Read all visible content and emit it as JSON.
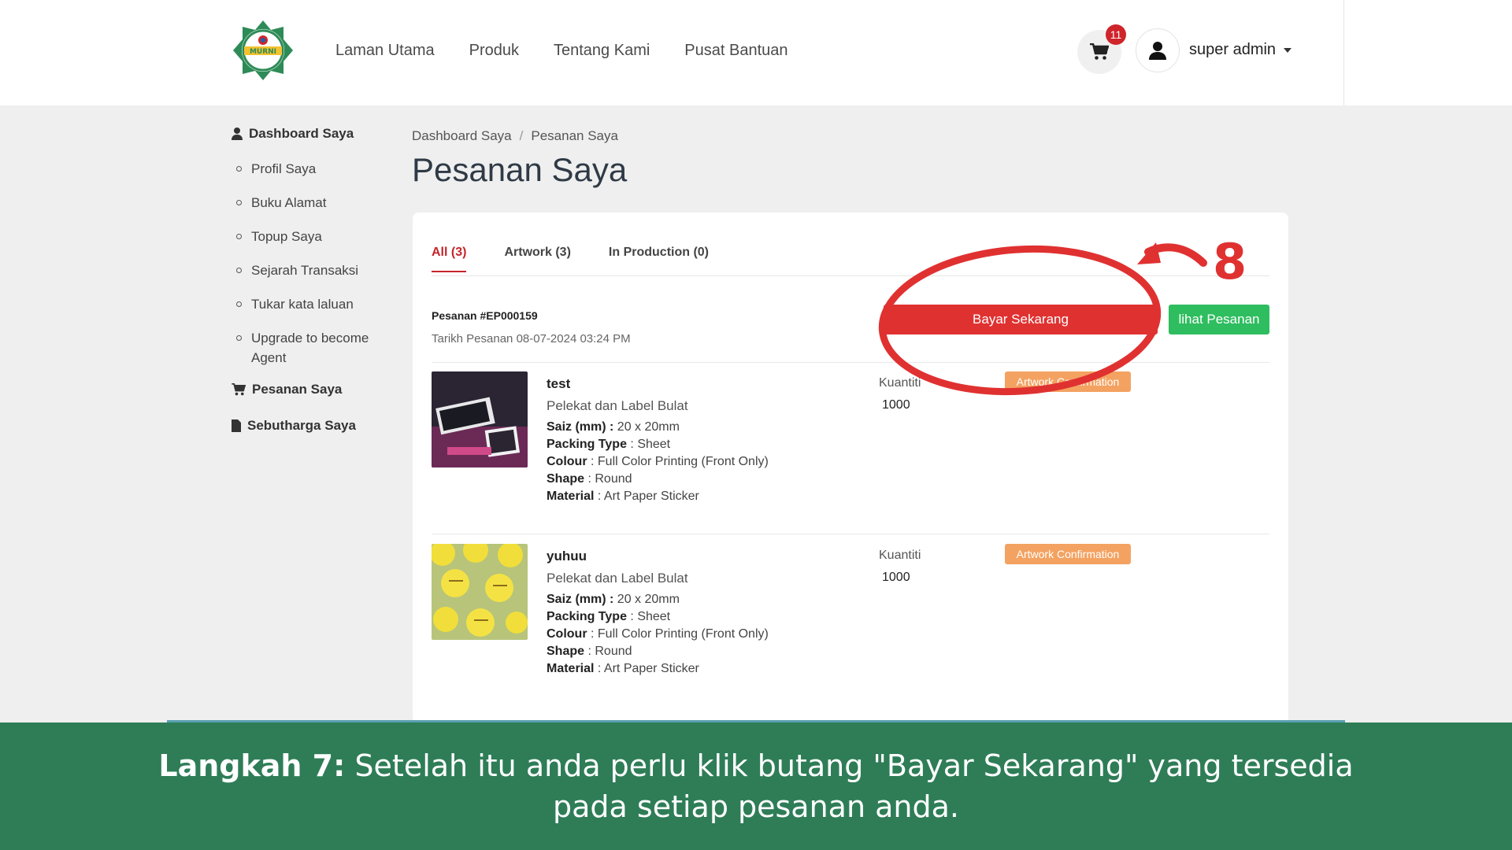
{
  "header": {
    "logo_text": "MURNI",
    "nav": [
      "Laman Utama",
      "Produk",
      "Tentang Kami",
      "Pusat Bantuan"
    ],
    "cart_count": "11",
    "user_name": "super admin"
  },
  "sidebar": {
    "dashboard": "Dashboard Saya",
    "items": [
      "Profil Saya",
      "Buku Alamat",
      "Topup Saya",
      "Sejarah Transaksi",
      "Tukar kata laluan",
      "Upgrade to become Agent"
    ],
    "orders": "Pesanan Saya",
    "quotes": "Sebutharga Saya"
  },
  "breadcrumb": [
    "Dashboard Saya",
    "Pesanan Saya"
  ],
  "page_title": "Pesanan Saya",
  "tabs": [
    {
      "label": "All (3)",
      "active": true
    },
    {
      "label": "Artwork (3)",
      "active": false
    },
    {
      "label": "In Production (0)",
      "active": false
    }
  ],
  "order": {
    "number": "Pesanan #EP000159",
    "date": "Tarikh Pesanan 08-07-2024 03:24 PM",
    "pay_label": "Bayar Sekarang",
    "view_label": "lihat Pesanan"
  },
  "items": [
    {
      "name": "test",
      "category": "Pelekat dan Label Bulat",
      "size_label": "Saiz (mm) :",
      "size": "20 x 20mm",
      "packing_label": "Packing Type",
      "packing": "Sheet",
      "colour_label": "Colour",
      "colour": "Full Color Printing (Front Only)",
      "shape_label": "Shape",
      "shape": "Round",
      "material_label": "Material",
      "material": "Art Paper Sticker",
      "qty_label": "Kuantiti",
      "qty": "1000",
      "status": "Artwork Confirmation"
    },
    {
      "name": "yuhuu",
      "category": "Pelekat dan Label Bulat",
      "size_label": "Saiz (mm) :",
      "size": "20 x 20mm",
      "packing_label": "Packing Type",
      "packing": "Sheet",
      "colour_label": "Colour",
      "colour": "Full Color Printing (Front Only)",
      "shape_label": "Shape",
      "shape": "Round",
      "material_label": "Material",
      "material": "Art Paper Sticker",
      "qty_label": "Kuantiti",
      "qty": "1000",
      "status": "Artwork Confirmation"
    }
  ],
  "annotation": {
    "step_number": "8"
  },
  "caption": {
    "step": "Langkah 7:",
    "text": "Setelah itu anda perlu klik butang \"Bayar Sekarang\" yang tersedia pada setiap pesanan anda."
  },
  "colors": {
    "accent_red": "#e03131",
    "green": "#2ebd5f",
    "caption_bg": "#2e7d57",
    "status_orange": "#f4a261"
  }
}
